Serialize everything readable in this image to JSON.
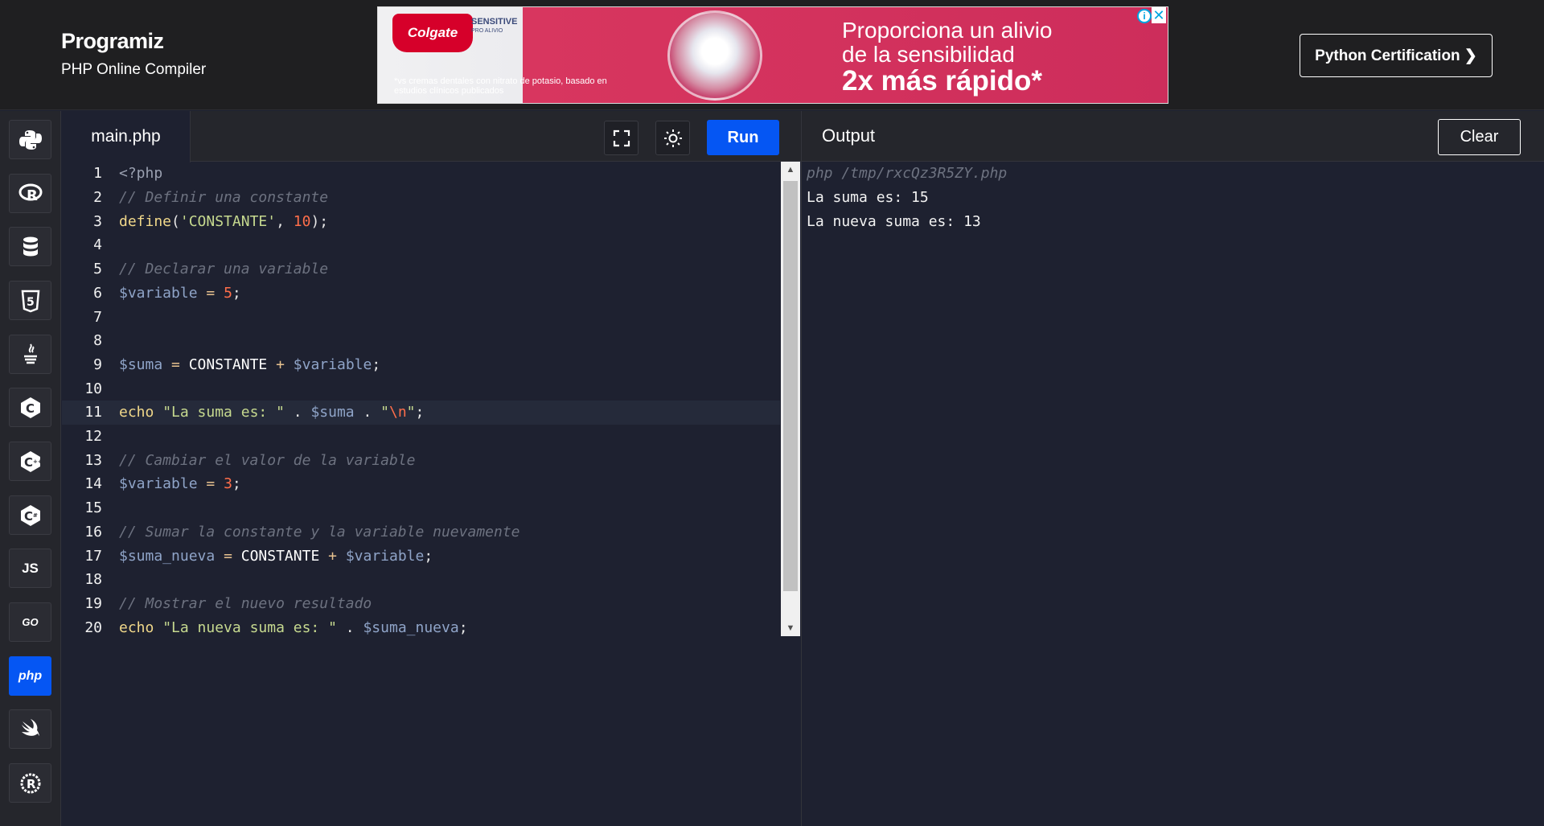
{
  "header": {
    "brand": "Programiz",
    "subtitle": "PHP Online Compiler",
    "cert_button": "Python Certification ❯"
  },
  "ad": {
    "brand": "Colgate",
    "product": "SENSITIVE",
    "product_sub": "PRO ALIVIO",
    "headline_1": "Proporciona un alivio",
    "headline_2": "de la sensibilidad",
    "headline_3": "2x más rápido*",
    "fine_print": "*vs cremas dentales con nitrato de potasio, basado en estudios clínicos publicados",
    "info_icon": "i",
    "close_icon": "✕"
  },
  "sidebar": {
    "items": [
      {
        "name": "python",
        "label": ""
      },
      {
        "name": "r",
        "label": "R"
      },
      {
        "name": "sql",
        "label": ""
      },
      {
        "name": "html",
        "label": "5"
      },
      {
        "name": "java",
        "label": ""
      },
      {
        "name": "c",
        "label": "C"
      },
      {
        "name": "cpp",
        "label": "C"
      },
      {
        "name": "csharp",
        "label": "C"
      },
      {
        "name": "js",
        "label": "JS"
      },
      {
        "name": "go",
        "label": "GO"
      },
      {
        "name": "php",
        "label": "php"
      },
      {
        "name": "swift",
        "label": ""
      },
      {
        "name": "rust",
        "label": "R"
      }
    ],
    "active": "php"
  },
  "editor": {
    "file_tab": "main.php",
    "run_label": "Run",
    "active_line": 11,
    "lines": [
      "1",
      "2",
      "3",
      "4",
      "5",
      "6",
      "7",
      "8",
      "9",
      "10",
      "11",
      "12",
      "13",
      "14",
      "15",
      "16",
      "17",
      "18",
      "19",
      "20"
    ]
  },
  "output": {
    "title": "Output",
    "clear_label": "Clear",
    "command": "php /tmp/rxcQz3R5ZY.php",
    "lines": [
      "La suma es: 15",
      "La nueva suma es: 13"
    ]
  }
}
